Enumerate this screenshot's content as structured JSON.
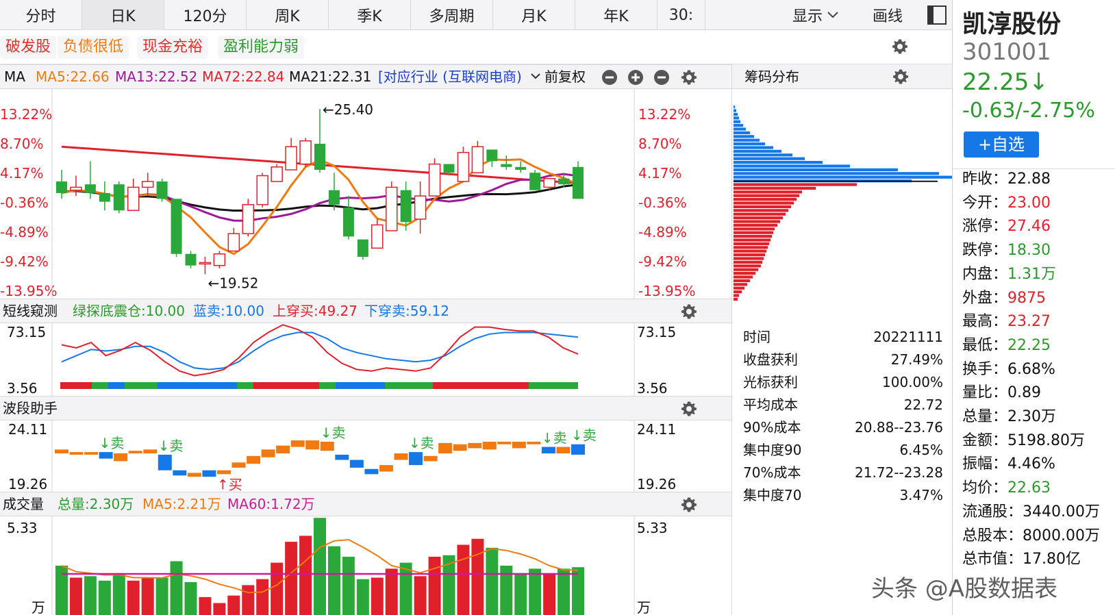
{
  "tabs": [
    {
      "label": "分时"
    },
    {
      "label": "日K"
    },
    {
      "label": "120分"
    },
    {
      "label": "周K"
    },
    {
      "label": "季K"
    },
    {
      "label": "多周期"
    },
    {
      "label": "月K"
    },
    {
      "label": "年K"
    },
    {
      "label": "30:"
    }
  ],
  "active_tab": "日K",
  "toolbar": {
    "display_label": "显示",
    "draw_label": "画线"
  },
  "tags": [
    {
      "label": "破发股",
      "color": "#e0302a"
    },
    {
      "label": "负债很低",
      "color": "#f07a10"
    },
    {
      "label": "现金充裕",
      "color": "#e0302a"
    },
    {
      "label": "盈利能力弱",
      "color": "#2a9a2a"
    }
  ],
  "ma_header": {
    "name": "MA",
    "ma5": "MA5:22.66",
    "ma13": "MA13:22.52",
    "ma72": "MA72:22.84",
    "ma21": "MA21:22.31",
    "industry": "[对应行业 (互联网电商)",
    "adjust": "前复权"
  },
  "colors": {
    "up": "#e0202a",
    "down": "#2aa83a",
    "ma5": "#f07a10",
    "ma13": "#a0189a",
    "ma72": "#e0202a",
    "ma21": "#111111",
    "blue": "#1677e6"
  },
  "kline_axis": [
    "13.22%",
    "8.70%",
    "4.17%",
    "-0.36%",
    "-4.89%",
    "-9.42%",
    "-13.95%"
  ],
  "annotations": {
    "high": "←25.40",
    "low": "←19.52"
  },
  "indicator1": {
    "name": "短线窥测",
    "l1": "绿探底震仓:10.00",
    "l2": "蓝卖:10.00",
    "l3": "上穿买:49.27",
    "l4": "下穿卖:59.12",
    "axis_top": "73.15",
    "axis_bottom": "3.56"
  },
  "indicator2": {
    "name": "波段助手",
    "axis_top": "24.11",
    "axis_bottom": "19.26",
    "sell": "↓卖",
    "buy": "↑买"
  },
  "volume": {
    "name": "成交量",
    "total": "总量:2.30万",
    "ma5": "MA5:2.21万",
    "ma60": "MA60:1.72万",
    "axis_top": "5.33",
    "axis_unit": "万"
  },
  "chip": {
    "title": "筹码分布",
    "stats": [
      {
        "k": "时间",
        "v": "20221111"
      },
      {
        "k": "收盘获利",
        "v": "27.49%"
      },
      {
        "k": "光标获利",
        "v": "100.00%"
      },
      {
        "k": "平均成本",
        "v": "22.72"
      },
      {
        "k": "90%成本",
        "v": "20.88--23.76"
      },
      {
        "k": "集中度90",
        "v": "6.45%"
      },
      {
        "k": "70%成本",
        "v": "21.72--23.28"
      },
      {
        "k": "集中度70",
        "v": "3.47%"
      }
    ]
  },
  "quote": {
    "name": "凯淳股份",
    "code": "301001",
    "price": "22.25↓",
    "change": "-0.63/-2.75%",
    "watch_label": "+自选",
    "rows": [
      {
        "k": "昨收：",
        "v": "22.88",
        "c": "#111111"
      },
      {
        "k": "今开：",
        "v": "23.00",
        "c": "#e0202a"
      },
      {
        "k": "涨停：",
        "v": "27.46",
        "c": "#e0202a"
      },
      {
        "k": "跌停：",
        "v": "18.30",
        "c": "#2a9a2a"
      },
      {
        "k": "内盘：",
        "v": "1.31万",
        "c": "#2a9a2a"
      },
      {
        "k": "外盘：",
        "v": "9875",
        "c": "#e0202a"
      },
      {
        "k": "最高：",
        "v": "23.27",
        "c": "#e0202a"
      },
      {
        "k": "最低：",
        "v": "22.25",
        "c": "#2a9a2a"
      },
      {
        "k": "换手：",
        "v": "6.68%",
        "c": "#111111"
      },
      {
        "k": "量比：",
        "v": "0.89",
        "c": "#111111"
      },
      {
        "k": "总量：",
        "v": "2.30万",
        "c": "#111111"
      },
      {
        "k": "金额：",
        "v": "5198.80万",
        "c": "#111111"
      },
      {
        "k": "振幅：",
        "v": "4.46%",
        "c": "#111111"
      },
      {
        "k": "均价：",
        "v": "22.63",
        "c": "#2a9a2a"
      },
      {
        "k": "流通股：",
        "v": "3440.00万",
        "c": "#111111"
      },
      {
        "k": "总股本：",
        "v": "8000.00万",
        "c": "#111111"
      },
      {
        "k": "总市值：",
        "v": "17.80亿",
        "c": "#111111"
      }
    ]
  },
  "watermark": "头条 @A股数据表",
  "candles": [
    {
      "o": 22.9,
      "h": 23.3,
      "l": 22.3,
      "c": 22.5
    },
    {
      "o": 22.6,
      "h": 23.1,
      "l": 22.4,
      "c": 22.7
    },
    {
      "o": 22.8,
      "h": 23.6,
      "l": 22.3,
      "c": 22.5
    },
    {
      "o": 22.5,
      "h": 22.9,
      "l": 21.9,
      "c": 22.2
    },
    {
      "o": 22.8,
      "h": 22.9,
      "l": 21.8,
      "c": 21.9
    },
    {
      "o": 21.9,
      "h": 23.0,
      "l": 21.9,
      "c": 22.7
    },
    {
      "o": 22.7,
      "h": 23.2,
      "l": 22.4,
      "c": 22.9
    },
    {
      "o": 22.9,
      "h": 23.0,
      "l": 22.2,
      "c": 22.3
    },
    {
      "o": 22.3,
      "h": 22.3,
      "l": 20.3,
      "c": 20.4
    },
    {
      "o": 20.4,
      "h": 20.5,
      "l": 19.9,
      "c": 20.0
    },
    {
      "o": 20.1,
      "h": 20.3,
      "l": 19.7,
      "c": 20.1
    },
    {
      "o": 20.0,
      "h": 20.5,
      "l": 19.9,
      "c": 20.4
    },
    {
      "o": 20.5,
      "h": 21.3,
      "l": 20.5,
      "c": 21.1
    },
    {
      "o": 21.1,
      "h": 22.3,
      "l": 21.0,
      "c": 22.1
    },
    {
      "o": 22.1,
      "h": 23.2,
      "l": 22.0,
      "c": 23.1
    },
    {
      "o": 22.9,
      "h": 23.5,
      "l": 22.9,
      "c": 23.4
    },
    {
      "o": 23.3,
      "h": 24.4,
      "l": 23.3,
      "c": 24.1
    },
    {
      "o": 23.5,
      "h": 24.4,
      "l": 23.4,
      "c": 24.3
    },
    {
      "o": 24.2,
      "h": 25.4,
      "l": 23.2,
      "c": 23.3
    },
    {
      "o": 22.6,
      "h": 23.2,
      "l": 21.9,
      "c": 22.1
    },
    {
      "o": 22.0,
      "h": 22.4,
      "l": 20.9,
      "c": 21.0
    },
    {
      "o": 20.9,
      "h": 20.9,
      "l": 20.2,
      "c": 20.3
    },
    {
      "o": 20.6,
      "h": 21.6,
      "l": 20.6,
      "c": 21.4
    },
    {
      "o": 21.2,
      "h": 22.9,
      "l": 21.2,
      "c": 22.7
    },
    {
      "o": 22.6,
      "h": 22.9,
      "l": 21.2,
      "c": 21.5
    },
    {
      "o": 21.6,
      "h": 22.9,
      "l": 21.1,
      "c": 22.4
    },
    {
      "o": 22.4,
      "h": 23.7,
      "l": 22.4,
      "c": 23.5
    },
    {
      "o": 23.5,
      "h": 23.5,
      "l": 23.1,
      "c": 23.2
    },
    {
      "o": 22.9,
      "h": 24.1,
      "l": 22.9,
      "c": 23.9
    },
    {
      "o": 23.2,
      "h": 24.3,
      "l": 23.2,
      "c": 24.1
    },
    {
      "o": 24.0,
      "h": 24.0,
      "l": 23.4,
      "c": 23.6
    },
    {
      "o": 23.5,
      "h": 23.8,
      "l": 23.3,
      "c": 23.4
    },
    {
      "o": 23.4,
      "h": 23.6,
      "l": 23.2,
      "c": 23.3
    },
    {
      "o": 23.2,
      "h": 23.3,
      "l": 22.6,
      "c": 22.6
    },
    {
      "o": 22.7,
      "h": 23.0,
      "l": 22.6,
      "c": 23.0
    },
    {
      "o": 23.0,
      "h": 23.2,
      "l": 22.7,
      "c": 22.8
    },
    {
      "o": 23.4,
      "h": 23.6,
      "l": 22.3,
      "c": 22.3
    }
  ],
  "volumes": [
    3.3,
    2.5,
    2.6,
    2.3,
    2.8,
    2.3,
    2.5,
    2.5,
    3.6,
    2.2,
    1.2,
    0.8,
    1.3,
    2.0,
    2.4,
    3.5,
    4.9,
    5.3,
    6.5,
    4.6,
    3.9,
    2.4,
    2.5,
    3.1,
    3.5,
    2.6,
    3.9,
    4.0,
    4.7,
    5.1,
    4.5,
    3.3,
    2.8,
    3.1,
    2.8,
    3.1,
    3.2
  ],
  "waves": [
    {
      "o": 22.3,
      "c": 22.0,
      "col": "orange"
    },
    {
      "o": 22.1,
      "c": 21.9,
      "col": "orange"
    },
    {
      "o": 22.1,
      "c": 21.9,
      "col": "orange"
    },
    {
      "o": 22.1,
      "c": 21.6,
      "col": "blue"
    },
    {
      "o": 22.0,
      "c": 21.4,
      "col": "orange"
    },
    {
      "o": 22.2,
      "c": 22.0,
      "col": "orange"
    },
    {
      "o": 22.3,
      "c": 22.0,
      "col": "orange"
    },
    {
      "o": 21.9,
      "c": 20.7,
      "col": "blue"
    },
    {
      "o": 20.7,
      "c": 20.3,
      "col": "blue"
    },
    {
      "o": 20.5,
      "c": 20.2,
      "col": "orange"
    },
    {
      "o": 20.7,
      "c": 20.2,
      "col": "blue"
    },
    {
      "o": 20.7,
      "c": 20.4,
      "col": "orange"
    },
    {
      "o": 21.3,
      "c": 20.9,
      "col": "orange"
    },
    {
      "o": 21.8,
      "c": 21.2,
      "col": "orange"
    },
    {
      "o": 22.3,
      "c": 21.7,
      "col": "orange"
    },
    {
      "o": 22.6,
      "c": 22.0,
      "col": "orange"
    },
    {
      "o": 23.0,
      "c": 22.5,
      "col": "orange"
    },
    {
      "o": 23.0,
      "c": 22.3,
      "col": "orange"
    },
    {
      "o": 22.9,
      "c": 22.2,
      "col": "orange"
    },
    {
      "o": 21.9,
      "c": 21.5,
      "col": "blue"
    },
    {
      "o": 21.5,
      "c": 20.9,
      "col": "blue"
    },
    {
      "o": 20.8,
      "c": 20.4,
      "col": "blue"
    },
    {
      "o": 21.1,
      "c": 20.6,
      "col": "orange"
    },
    {
      "o": 22.0,
      "c": 21.5,
      "col": "orange"
    },
    {
      "o": 22.1,
      "c": 21.1,
      "col": "blue"
    },
    {
      "o": 21.8,
      "c": 21.4,
      "col": "orange"
    },
    {
      "o": 22.8,
      "c": 22.0,
      "col": "orange"
    },
    {
      "o": 22.7,
      "c": 22.2,
      "col": "orange"
    },
    {
      "o": 22.8,
      "c": 22.4,
      "col": "orange"
    },
    {
      "o": 22.9,
      "c": 22.3,
      "col": "orange"
    },
    {
      "o": 22.9,
      "c": 22.7,
      "col": "orange"
    },
    {
      "o": 22.9,
      "c": 22.4,
      "col": "orange"
    },
    {
      "o": 22.9,
      "c": 22.7,
      "col": "orange"
    },
    {
      "o": 22.5,
      "c": 22.0,
      "col": "blue"
    },
    {
      "o": 22.5,
      "c": 22.0,
      "col": "orange"
    },
    {
      "o": 22.7,
      "c": 21.9,
      "col": "blue"
    }
  ],
  "sell_marks": [
    3,
    7,
    18,
    24,
    33,
    35
  ],
  "buy_marks": [
    11
  ],
  "osc_red": [
    52,
    48,
    55,
    38,
    45,
    55,
    45,
    30,
    18,
    12,
    15,
    20,
    35,
    55,
    68,
    78,
    72,
    62,
    42,
    28,
    20,
    18,
    22,
    20,
    18,
    22,
    40,
    62,
    75,
    75,
    72,
    70,
    70,
    62,
    48,
    40
  ],
  "osc_blue": [
    30,
    38,
    46,
    44,
    46,
    50,
    50,
    42,
    30,
    22,
    20,
    22,
    30,
    44,
    56,
    64,
    68,
    68,
    60,
    48,
    42,
    38,
    34,
    32,
    30,
    32,
    38,
    50,
    60,
    66,
    68,
    68,
    68,
    66,
    64,
    62
  ]
}
